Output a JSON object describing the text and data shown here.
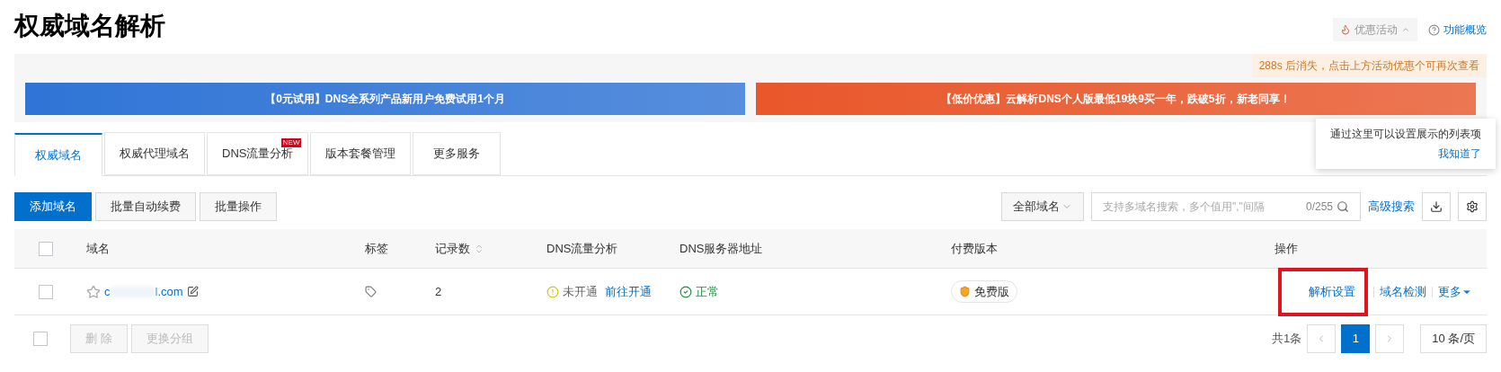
{
  "page_title": "权威域名解析",
  "header_links": [
    {
      "kind": "promo",
      "label": "优惠活动"
    },
    {
      "kind": "help",
      "label": "功能概览"
    }
  ],
  "notice": "288s 后消失，点击上方活动优惠个可再次查看",
  "banners": [
    {
      "text": "【0元试用】DNS全系列产品新用户免费试用1个月",
      "color": "#2f74d6"
    },
    {
      "text": "【低价优惠】云解析DNS个人版最低19块9买一年，跌破5折，新老同享！",
      "color": "#e9572a"
    }
  ],
  "tabs": [
    {
      "label": "权威域名",
      "selected": true
    },
    {
      "label": "权威代理域名",
      "selected": false
    },
    {
      "label": "DNS流量分析",
      "selected": false,
      "badge": "NEW"
    },
    {
      "label": "版本套餐管理",
      "selected": false
    },
    {
      "label": "更多服务",
      "selected": false
    }
  ],
  "popover": {
    "text": "通过这里可以设置展示的列表项",
    "link": "我知道了"
  },
  "toolbar": {
    "buttons": [
      {
        "label": "添加域名",
        "primary": true
      },
      {
        "label": "批量自动续费",
        "primary": false
      },
      {
        "label": "批量操作",
        "primary": false
      }
    ],
    "filter": "全部域名",
    "search_placeholder": "支持多域名搜索，多个值用\",\"间隔",
    "search_count": "0/255",
    "advanced_search": "高级搜索"
  },
  "table": {
    "all_checked": false,
    "columns": [
      "域名",
      "标签",
      "记录数",
      "DNS流量分析",
      "DNS服务器地址",
      "付费版本",
      "操作"
    ],
    "rows": [
      {
        "checked": false,
        "starred": false,
        "domain_start": "c",
        "domain_end": "l.com",
        "records": "2",
        "traffic_status": "未开通",
        "traffic_link": "前往开通",
        "dns_status": "正常",
        "plan": "免费版",
        "actions": [
          {
            "label": "解析设置",
            "highlighted": true
          },
          {
            "label": "域名检测",
            "highlighted": false
          },
          {
            "label": "更多",
            "highlighted": false
          }
        ]
      }
    ]
  },
  "footer": {
    "checked": false,
    "buttons": [
      "删 除",
      "更换分组"
    ],
    "total": "共1条",
    "pages": [
      {
        "label": "1",
        "selected": true
      }
    ],
    "page_size": "10 条/页"
  }
}
